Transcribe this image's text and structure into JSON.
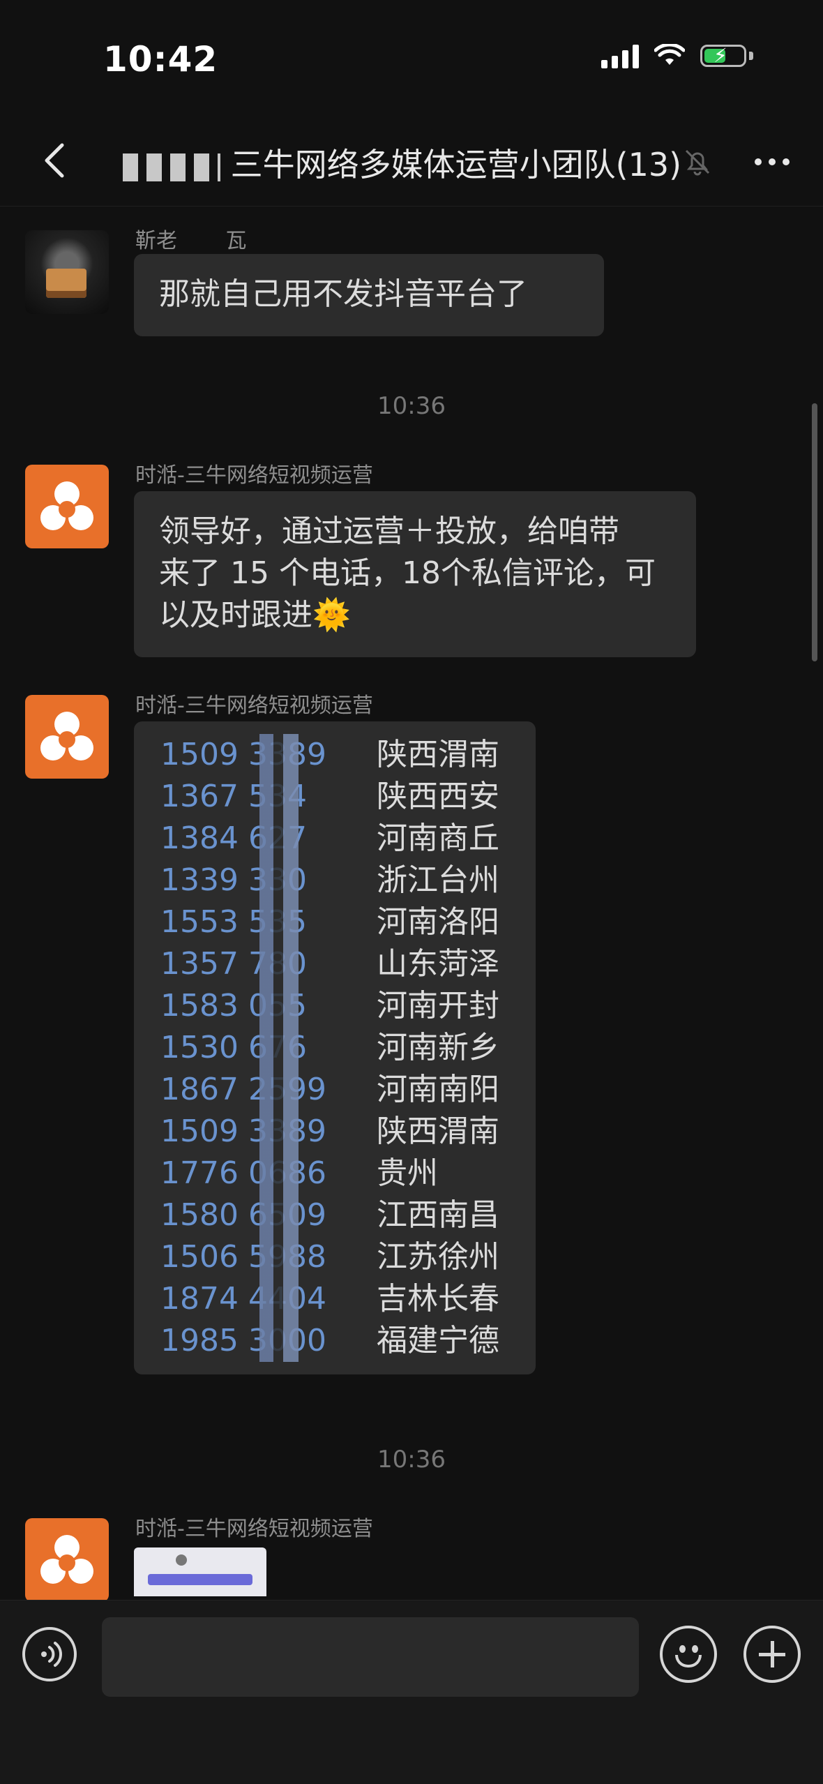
{
  "status": {
    "time": "10:42"
  },
  "nav": {
    "title_visible": "三牛网络多媒体运营小团队(13)",
    "back_icon": "chevron-left-icon",
    "mute_icon": "bell-slash-icon",
    "more_icon": "ellipsis-icon"
  },
  "messages": [
    {
      "sender": "靳老　 　瓦",
      "text_lines": [
        "那就自己用不发抖音平台了"
      ]
    },
    {
      "timestamp": "10:36"
    },
    {
      "sender": "时湉-三牛网络短视频运营",
      "text_lines": [
        "领导好，通过运营＋投放，给咱带",
        "来了 15 个电话，18个私信评论，可",
        "以及时跟进🌞"
      ]
    },
    {
      "sender": "时湉-三牛网络短视频运营",
      "phones": [
        {
          "num": "1509 3389",
          "loc": "陕西渭南"
        },
        {
          "num": "1367 534",
          "loc": "陕西西安"
        },
        {
          "num": "1384 627",
          "loc": "河南商丘"
        },
        {
          "num": "1339 330",
          "loc": "浙江台州"
        },
        {
          "num": "1553 535",
          "loc": "河南洛阳"
        },
        {
          "num": "1357 780",
          "loc": "山东菏泽"
        },
        {
          "num": "1583 055",
          "loc": "河南开封"
        },
        {
          "num": "1530 676",
          "loc": "河南新乡"
        },
        {
          "num": "1867 2599",
          "loc": "河南南阳"
        },
        {
          "num": "1509 3389",
          "loc": "陕西渭南"
        },
        {
          "num": "1776 0686",
          "loc": "贵州"
        },
        {
          "num": "1580 6509",
          "loc": "江西南昌"
        },
        {
          "num": "1506 5988",
          "loc": "江苏徐州"
        },
        {
          "num": "1874 4404",
          "loc": "吉林长春"
        },
        {
          "num": "1985 3000",
          "loc": "福建宁德"
        }
      ]
    },
    {
      "timestamp": "10:36"
    },
    {
      "sender": "时湉-三牛网络短视频运营"
    }
  ],
  "input": {
    "voice_icon": "voice-icon",
    "emoji_icon": "emoji-icon",
    "plus_icon": "plus-icon"
  }
}
